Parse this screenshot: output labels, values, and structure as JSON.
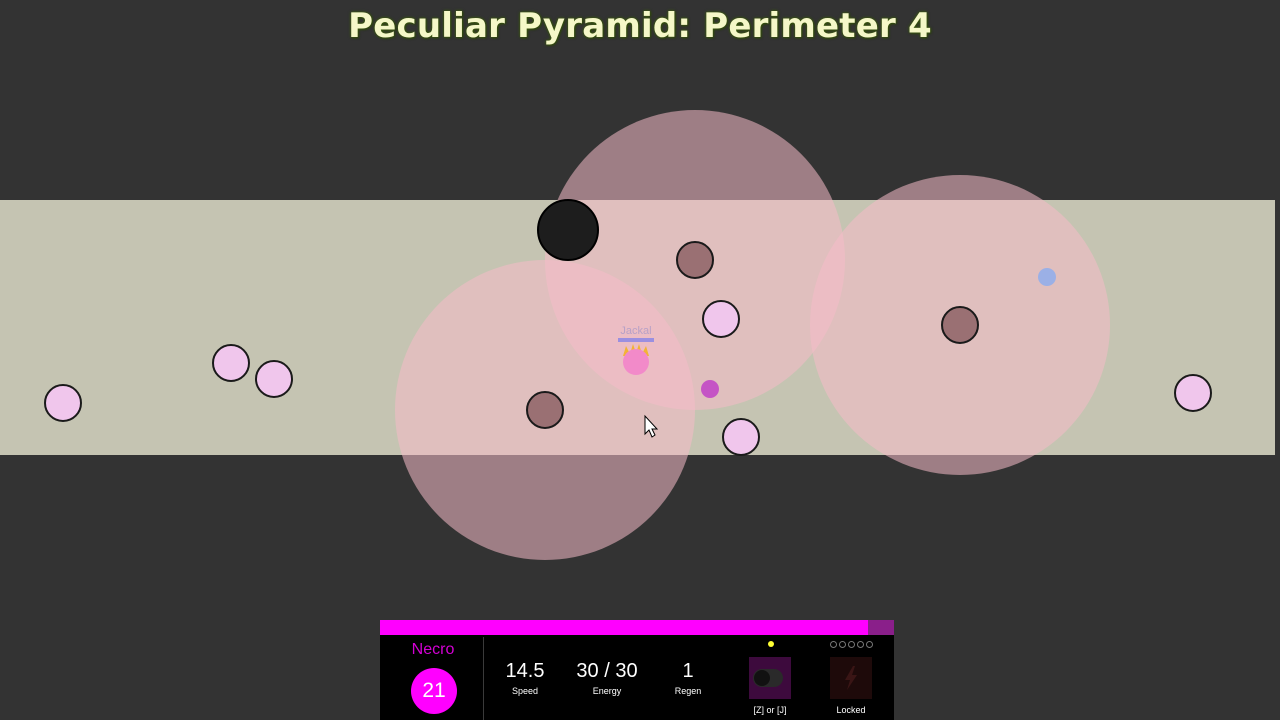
{
  "title": "Peculiar Pyramid: Perimeter 4",
  "player": {
    "name": "Jackal"
  },
  "hud": {
    "hero_name": "Necro",
    "level": "21",
    "xp_fraction": 0.95,
    "stats": [
      {
        "value": "14.5",
        "label": "Speed"
      },
      {
        "value": "30 / 30",
        "label": "Energy"
      },
      {
        "value": "1",
        "label": "Regen"
      }
    ],
    "abilities": [
      {
        "icon": "toggle-icon",
        "key_label": "[Z] or [J]"
      },
      {
        "icon": "lightning-icon",
        "key_label": "Locked"
      }
    ]
  },
  "colors": {
    "background": "#333333",
    "area": "#c5c4b2",
    "aura": "#f6bcc9",
    "enemy_pink": "#f0c6ec",
    "enemy_brown": "#9a7073",
    "hero": "#ff00ff"
  }
}
